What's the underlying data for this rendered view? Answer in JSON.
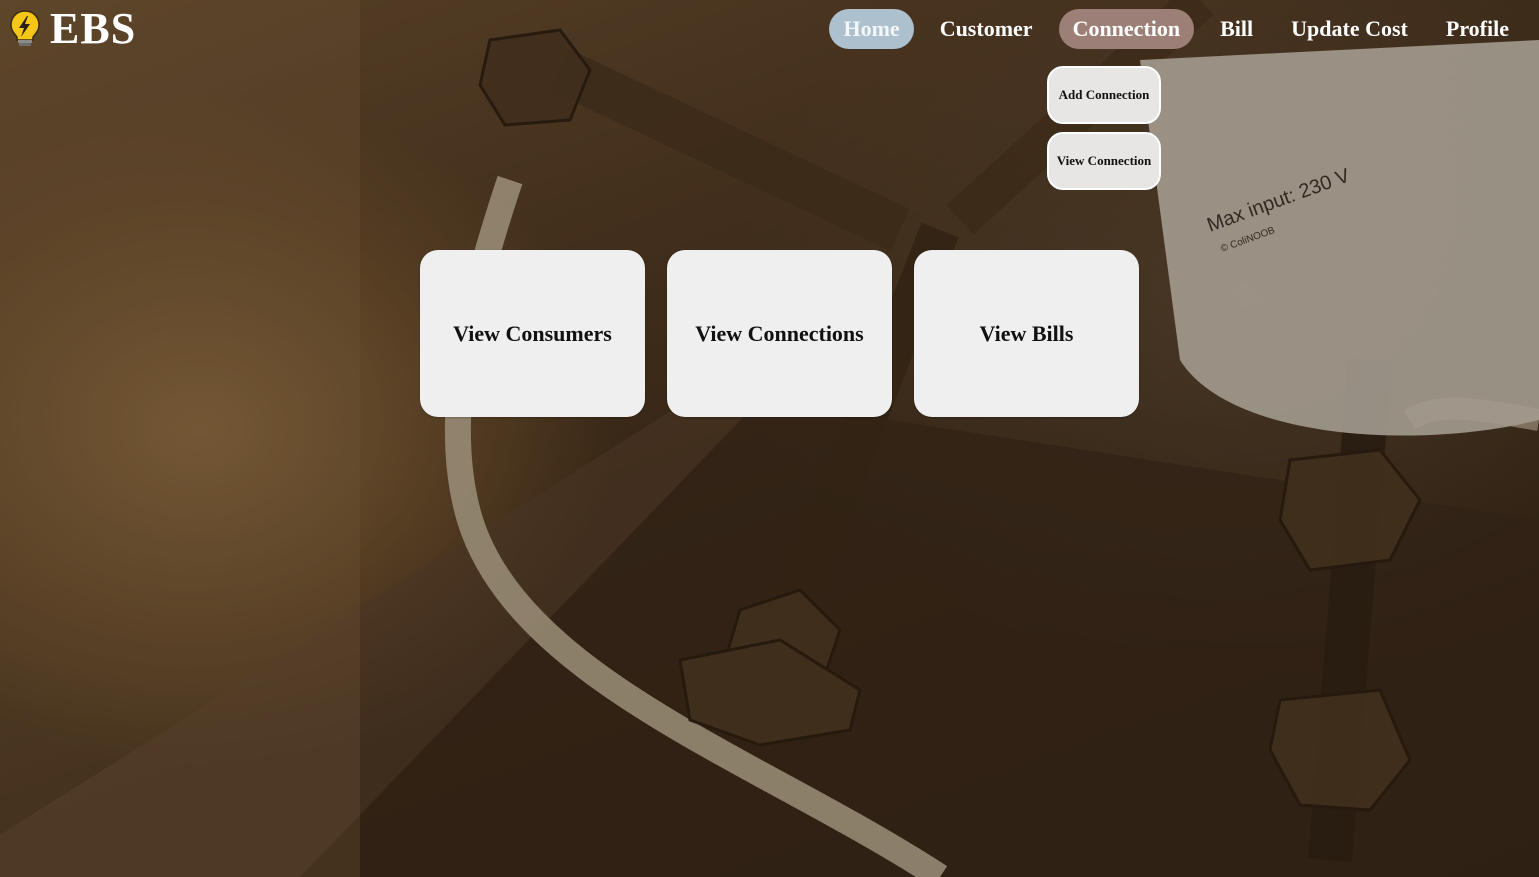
{
  "brand": {
    "title": "EBS",
    "icon": "lightbulb-bolt-icon"
  },
  "nav": {
    "items": [
      {
        "label": "Home"
      },
      {
        "label": "Customer"
      },
      {
        "label": "Connection"
      },
      {
        "label": "Bill"
      },
      {
        "label": "Update Cost"
      },
      {
        "label": "Profile"
      }
    ]
  },
  "dropdown": {
    "items": [
      {
        "label": "Add Connection"
      },
      {
        "label": "View Connection"
      }
    ]
  },
  "cards": [
    {
      "label": "View Consumers"
    },
    {
      "label": "View Connections"
    },
    {
      "label": "View Bills"
    }
  ],
  "background": {
    "plug_text": "Max input: 230 V",
    "plug_credit": "© ColiNOOB"
  },
  "colors": {
    "home_pill": "#adc0cd",
    "connection_pill": "#9c8077",
    "card_bg": "#efefef",
    "dropdown_bg": "#e8e6e5"
  }
}
